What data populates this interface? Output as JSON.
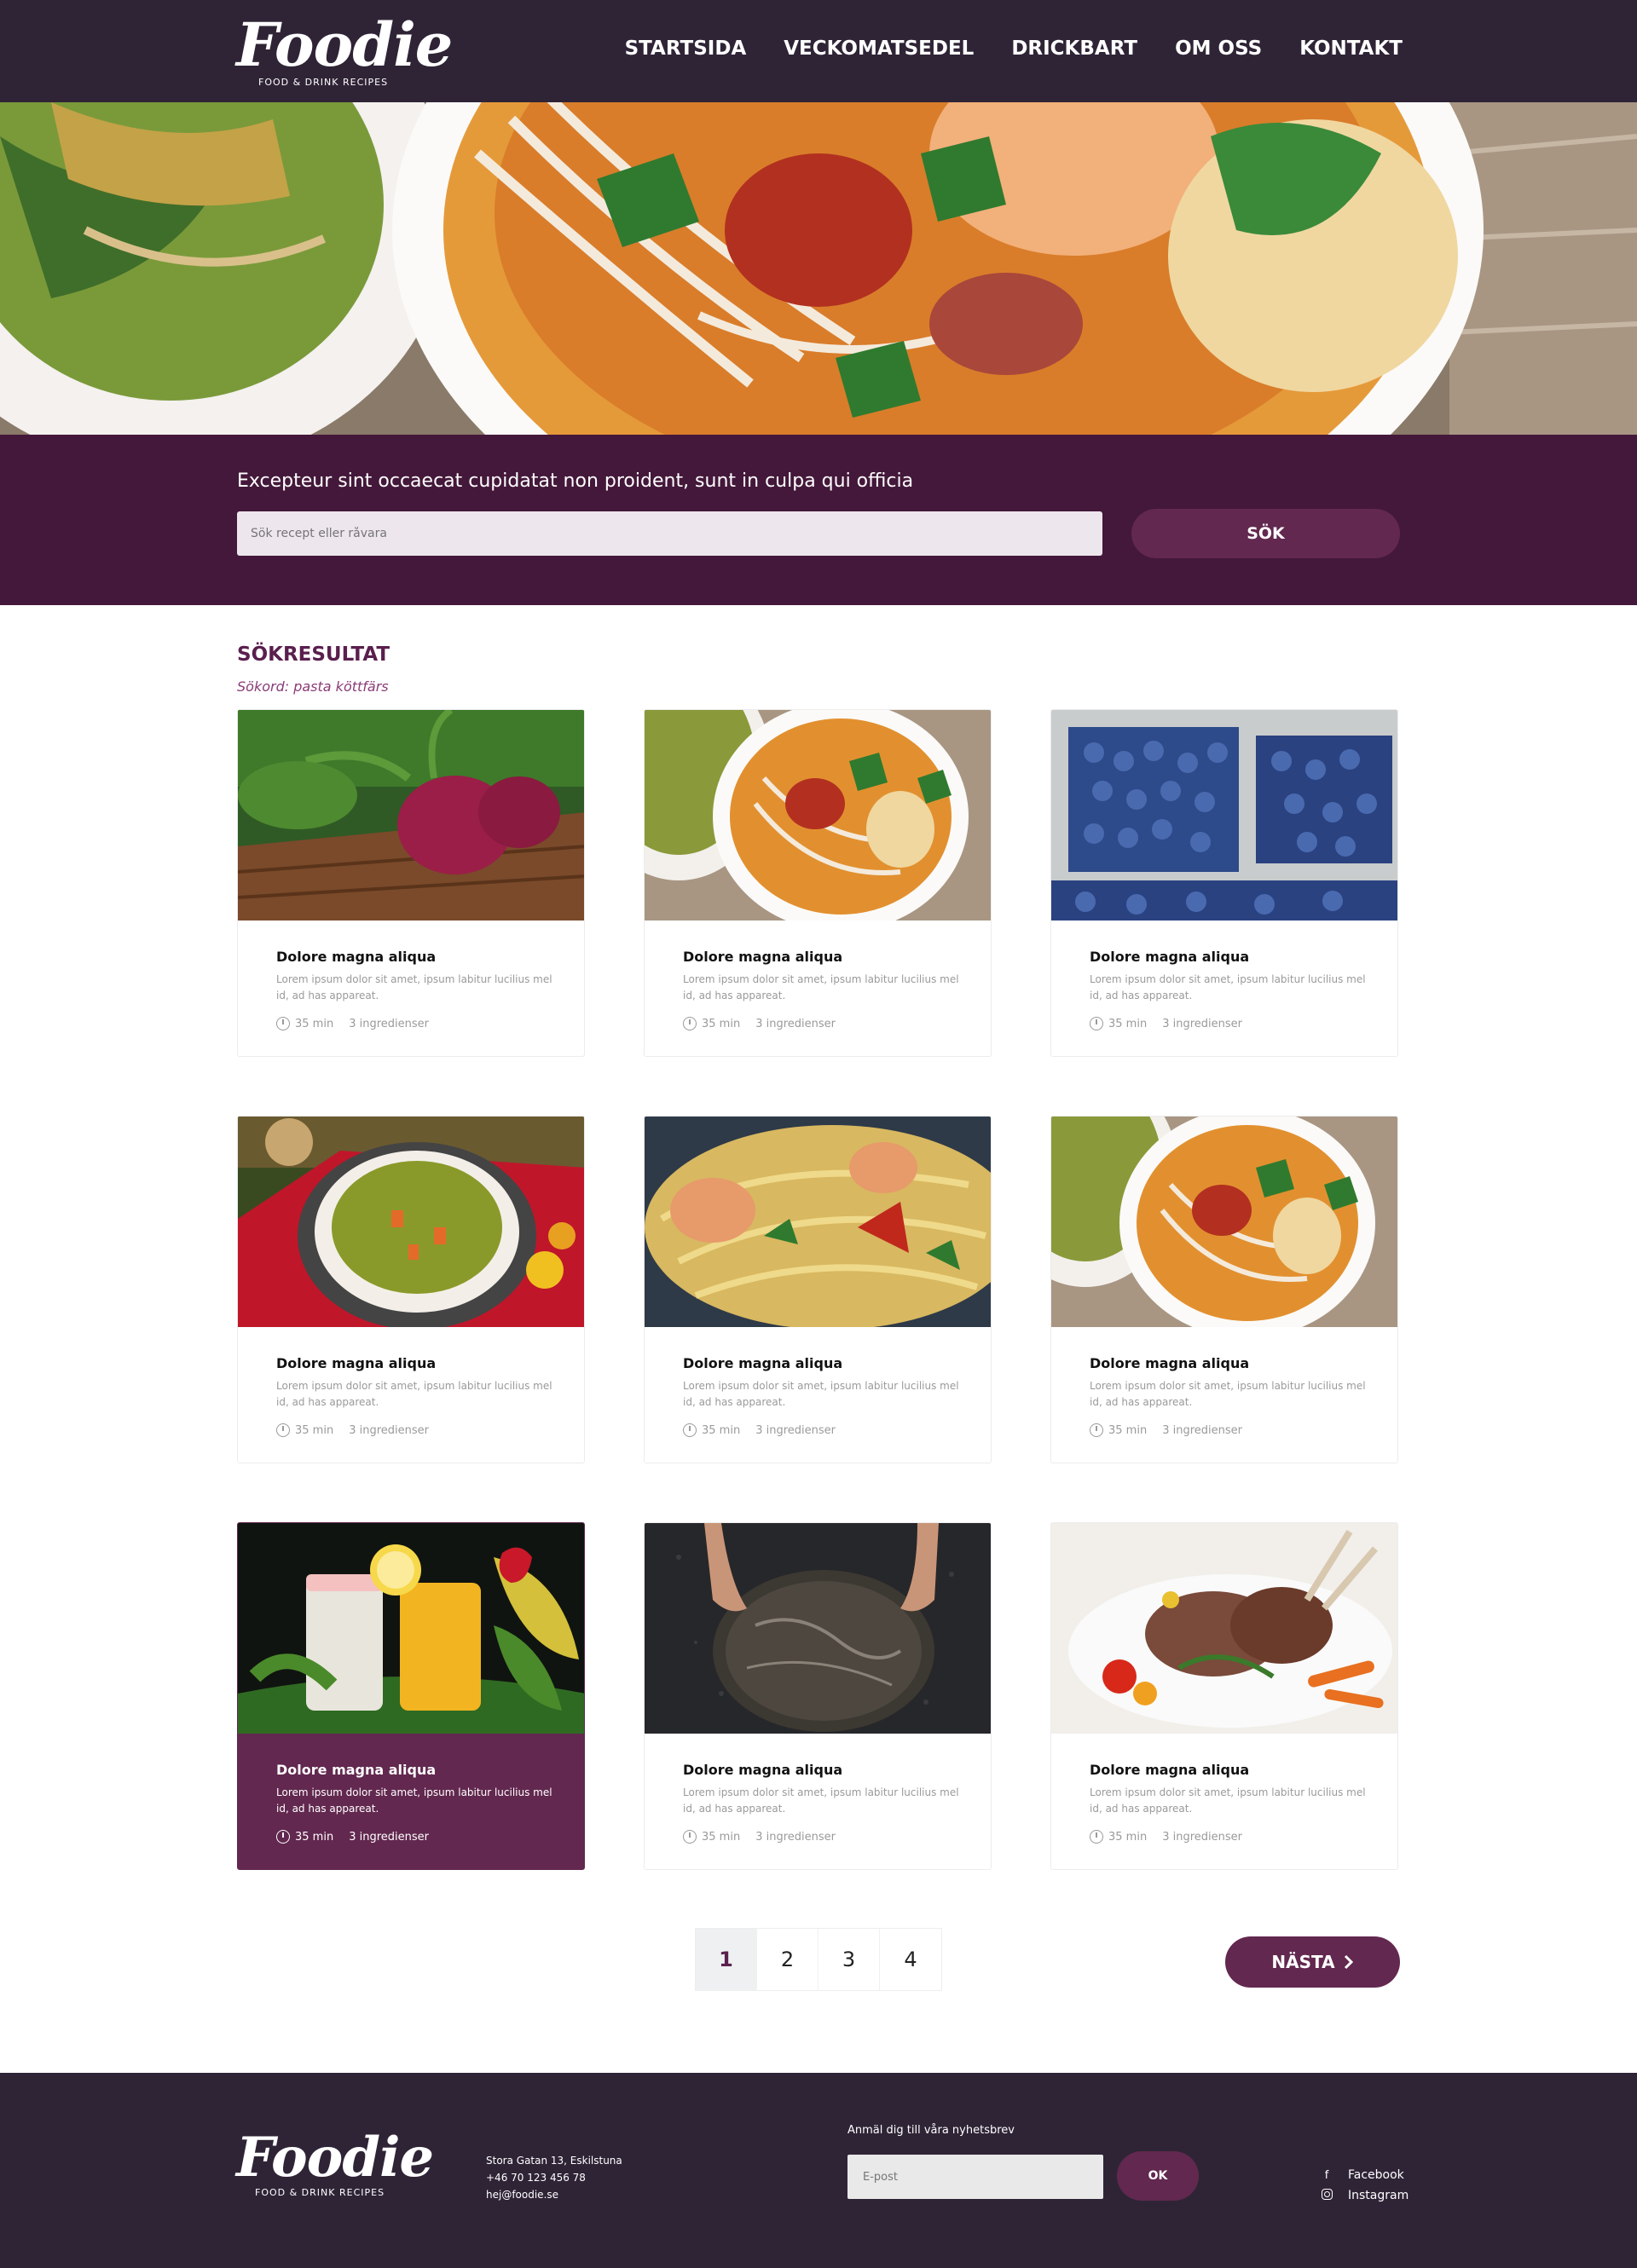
{
  "brand": {
    "name": "Foodie",
    "tagline": "FOOD & DRINK RECIPES"
  },
  "nav": [
    {
      "label": "STARTSIDA"
    },
    {
      "label": "VECKOMATSEDEL"
    },
    {
      "label": "DRICKBART"
    },
    {
      "label": "OM OSS"
    },
    {
      "label": "KONTAKT"
    }
  ],
  "search": {
    "tagline": "Excepteur sint occaecat cupidatat non proident, sunt in culpa qui officia",
    "placeholder": "Sök recept eller råvara",
    "button_label": "SÖK"
  },
  "results": {
    "title": "SÖKRESULTAT",
    "query_label": "Sökord: pasta köttfärs"
  },
  "cards": [
    {
      "title": "Dolore magna aliqua",
      "desc": "Lorem ipsum dolor sit amet, ipsum labitur lucilius mel id, ad has appareat.",
      "time": "35 min",
      "ingredients": "3 ingredienser",
      "image": "beets"
    },
    {
      "title": "Dolore magna aliqua",
      "desc": "Lorem ipsum dolor sit amet, ipsum labitur lucilius mel id, ad has appareat.",
      "time": "35 min",
      "ingredients": "3 ingredienser",
      "image": "noodle-soup"
    },
    {
      "title": "Dolore magna aliqua",
      "desc": "Lorem ipsum dolor sit amet, ipsum labitur lucilius mel id, ad has appareat.",
      "time": "35 min",
      "ingredients": "3 ingredienser",
      "image": "blueberries"
    },
    {
      "title": "Dolore magna aliqua",
      "desc": "Lorem ipsum dolor sit amet, ipsum labitur lucilius mel id, ad has appareat.",
      "time": "35 min",
      "ingredients": "3 ingredienser",
      "image": "vegetable-soup"
    },
    {
      "title": "Dolore magna aliqua",
      "desc": "Lorem ipsum dolor sit amet, ipsum labitur lucilius mel id, ad has appareat.",
      "time": "35 min",
      "ingredients": "3 ingredienser",
      "image": "shrimp-pasta"
    },
    {
      "title": "Dolore magna aliqua",
      "desc": "Lorem ipsum dolor sit amet, ipsum labitur lucilius mel id, ad has appareat.",
      "time": "35 min",
      "ingredients": "3 ingredienser",
      "image": "noodle-soup"
    },
    {
      "title": "Dolore magna aliqua",
      "desc": "Lorem ipsum dolor sit amet, ipsum labitur lucilius mel id, ad has appareat.",
      "time": "35 min",
      "ingredients": "3 ingredienser",
      "image": "lemonade",
      "active": true
    },
    {
      "title": "Dolore magna aliqua",
      "desc": "Lorem ipsum dolor sit amet, ipsum labitur lucilius mel id, ad has appareat.",
      "time": "35 min",
      "ingredients": "3 ingredienser",
      "image": "bread"
    },
    {
      "title": "Dolore magna aliqua",
      "desc": "Lorem ipsum dolor sit amet, ipsum labitur lucilius mel id, ad has appareat.",
      "time": "35 min",
      "ingredients": "3 ingredienser",
      "image": "lamb-chops"
    }
  ],
  "pagination": {
    "pages": [
      "1",
      "2",
      "3",
      "4"
    ],
    "current": "1",
    "next_label": "NÄSTA"
  },
  "footer": {
    "address": "Stora Gatan 13, Eskilstuna",
    "phone": "+46 70 123 456 78",
    "email": "hej@foodie.se",
    "newsletter_label": "Anmäl dig till våra nyhetsbrev",
    "email_placeholder": "E-post",
    "ok_label": "OK",
    "social": [
      {
        "label": "Facebook",
        "icon": "facebook-icon"
      },
      {
        "label": "Instagram",
        "icon": "instagram-icon"
      }
    ]
  },
  "colors": {
    "header": "#2f2436",
    "band": "#44183a",
    "accent": "#62284f",
    "title": "#5a1f4e"
  }
}
